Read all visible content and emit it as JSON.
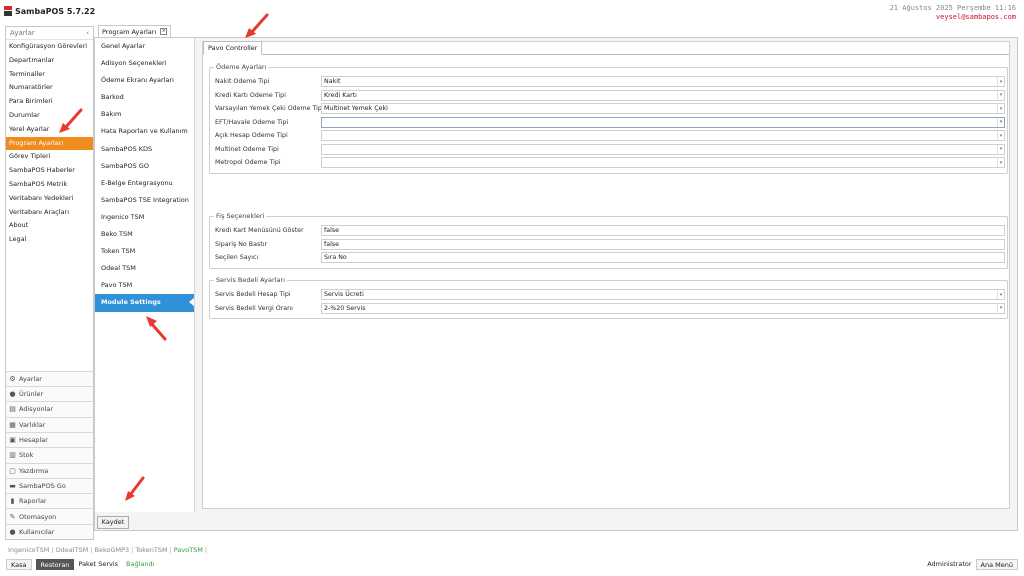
{
  "app": {
    "title": "SambaPOS 5.7.22",
    "date": "21 Ağustos 2025 Perşembe 11:16",
    "user_email": "veysel@sambapos.com"
  },
  "sidebar": {
    "header": "Ayarlar",
    "collapse_glyph": "‹",
    "items": [
      {
        "label": "Konfigürasyon Görevleri"
      },
      {
        "label": "Departmanlar"
      },
      {
        "label": "Terminaller"
      },
      {
        "label": "Numaratörler"
      },
      {
        "label": "Para Birimleri"
      },
      {
        "label": "Durumlar"
      },
      {
        "label": "Yerel Ayarlar"
      },
      {
        "label": "Program Ayarları",
        "active": true
      },
      {
        "label": "Görev Tipleri"
      },
      {
        "label": "SambaPOS Haberler"
      },
      {
        "label": "SambaPOS Metrik"
      },
      {
        "label": "Veritabanı Yedekleri"
      },
      {
        "label": "Veritabanı Araçları"
      },
      {
        "label": "About"
      },
      {
        "label": "Legal"
      }
    ],
    "modules": [
      {
        "label": "Ayarlar",
        "icon": "gear-icon"
      },
      {
        "label": "Ürünler",
        "icon": "cup-icon"
      },
      {
        "label": "Adisyonlar",
        "icon": "ticket-icon"
      },
      {
        "label": "Varlıklar",
        "icon": "table-icon"
      },
      {
        "label": "Hesaplar",
        "icon": "calculator-icon"
      },
      {
        "label": "Stok",
        "icon": "stock-icon"
      },
      {
        "label": "Yazdırma",
        "icon": "print-icon"
      },
      {
        "label": "SambaPOS Go",
        "icon": "car-icon"
      },
      {
        "label": "Raporlar",
        "icon": "chart-icon"
      },
      {
        "label": "Otomasyon",
        "icon": "wand-icon"
      },
      {
        "label": "Kullanıcılar",
        "icon": "user-icon"
      }
    ]
  },
  "document_tab": {
    "label": "Program Ayarları",
    "close_glyph": "×"
  },
  "settings_list": {
    "items": [
      {
        "label": "Genel Ayarlar"
      },
      {
        "label": "Adisyon Seçenekleri"
      },
      {
        "label": "Ödeme Ekranı Ayarları"
      },
      {
        "label": "Barkod"
      },
      {
        "label": "Bakım"
      },
      {
        "label": "Hata Raporları ve Kullanım"
      },
      {
        "label": "SambaPOS KDS"
      },
      {
        "label": "SambaPOS GO"
      },
      {
        "label": "E-Belge Entegrasyonu"
      },
      {
        "label": "SambaPOS TSE Integration"
      },
      {
        "label": "Ingenico TSM"
      },
      {
        "label": "Beko TSM"
      },
      {
        "label": "Token TSM"
      },
      {
        "label": "Odeal TSM"
      },
      {
        "label": "Pavo TSM"
      },
      {
        "label": "Module Settings",
        "active": true
      }
    ]
  },
  "content": {
    "tab_label": "Pavo Controller",
    "groups": [
      {
        "title": "Ödeme Ayarları",
        "rows": [
          {
            "label": "Nakit Ödeme Tipi",
            "value": "Nakit",
            "dropdown": true
          },
          {
            "label": "Kredi Kartı Ödeme Tipi",
            "value": "Kredi Kartı",
            "dropdown": true
          },
          {
            "label": "Varsayılan Yemek Çeki Ödeme Tipi",
            "value": "Multinet Yemek Çeki",
            "dropdown": true
          },
          {
            "label": "EFT/Havale Ödeme Tipi",
            "value": "",
            "dropdown": true,
            "focused": true
          },
          {
            "label": "Açık Hesap Ödeme Tipi",
            "value": "",
            "dropdown": true
          },
          {
            "label": "Multinet Ödeme Tipi",
            "value": "",
            "dropdown": true
          },
          {
            "label": "Metropol Ödeme Tipi",
            "value": "",
            "dropdown": true
          }
        ]
      },
      {
        "title": "Fiş Seçenekleri",
        "rows": [
          {
            "label": "Kredi Kart Menüsünü Göster",
            "value": "false",
            "dropdown": false
          },
          {
            "label": "Sipariş No Bastır",
            "value": "false",
            "dropdown": false
          },
          {
            "label": "Seçilen Sayıcı",
            "value": "Sıra No",
            "dropdown": false
          }
        ]
      },
      {
        "title": "Servis Bedeli Ayarları",
        "rows": [
          {
            "label": "Servis Bedeli Hesap Tipi",
            "value": "Servis Ücreti",
            "dropdown": true
          },
          {
            "label": "Servis Bedeli Vergi Oranı",
            "value": "2-%20 Servis",
            "dropdown": true
          }
        ]
      }
    ],
    "dropdown_glyph": "▾",
    "save_button": "Kaydet"
  },
  "devices": {
    "items": [
      {
        "label": "IngenicoTSM"
      },
      {
        "label": "OdealTSM"
      },
      {
        "label": "BekoGMP3"
      },
      {
        "label": "TokenTSM"
      },
      {
        "label": "PavoTSM",
        "active": true
      }
    ],
    "separator": "|"
  },
  "statusbar": {
    "kasa": "Kasa",
    "restoran": "Restoran",
    "paket_servis": "Paket Servis",
    "connection": "Bağlandı",
    "user": "Administrator",
    "menu_button": "Ana Menü"
  },
  "colors": {
    "active_orange": "#f08c1e",
    "active_blue": "#2f91d8",
    "brand_red": "#d9272e",
    "annotation_red": "#e8392f",
    "connected_green": "#2e9d3a"
  }
}
